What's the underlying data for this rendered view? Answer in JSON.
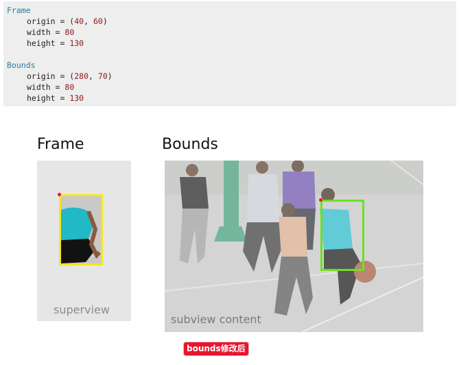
{
  "code": {
    "frame_label": "Frame",
    "frame_origin_prefix": "origin = (",
    "frame_origin_x": "40",
    "frame_origin_sep": ", ",
    "frame_origin_y": "60",
    "frame_origin_suffix": ")",
    "frame_width_prefix": "width = ",
    "frame_width": "80",
    "frame_height_prefix": "height = ",
    "frame_height": "130",
    "bounds_label": "Bounds",
    "bounds_origin_prefix": "origin = (",
    "bounds_origin_x": "280",
    "bounds_origin_sep": ", ",
    "bounds_origin_y": "70",
    "bounds_origin_suffix": ")",
    "bounds_width_prefix": "width = ",
    "bounds_width": "80",
    "bounds_height_prefix": "height = ",
    "bounds_height": "130"
  },
  "diagram": {
    "frame_title": "Frame",
    "bounds_title": "Bounds",
    "superview_caption": "superview",
    "subview_caption": "subview content",
    "frame_rect_color": "#f5e81a",
    "bounds_rect_color": "#6fe01e",
    "origin_dot_color": "#e8152c"
  },
  "note": {
    "label": "bounds修改后",
    "color": "#e8152c"
  }
}
